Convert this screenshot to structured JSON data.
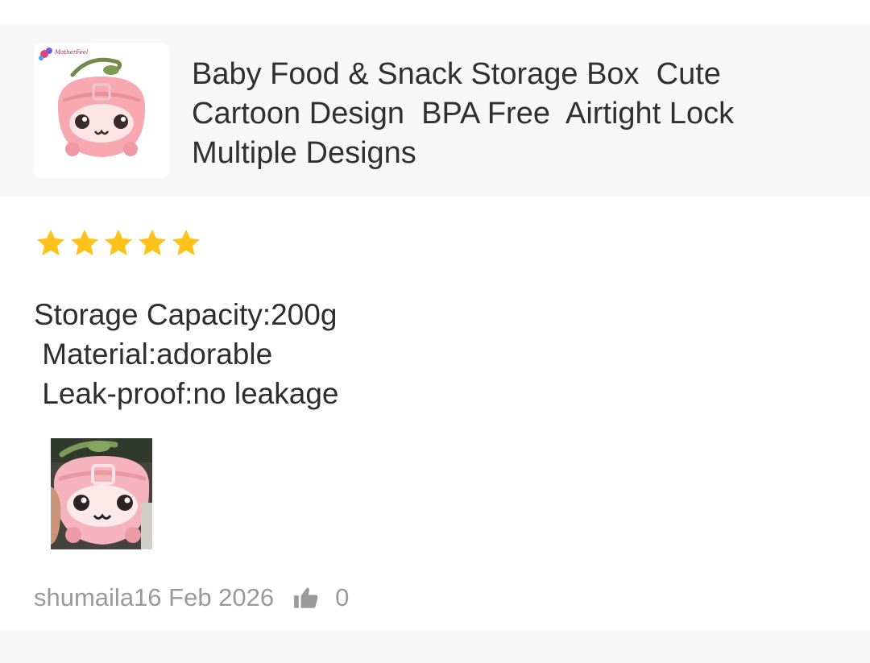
{
  "product": {
    "title": "Baby Food & Snack Storage Box  Cute\nCartoon Design  BPA Free  Airtight Lock\nMultiple Designs",
    "thumbnail_icon": "pink-apple-storage-box-image",
    "thumbnail_brand_text": "MotherFeel"
  },
  "review": {
    "rating": 5,
    "rating_max": 5,
    "star_color": "#FFC21A",
    "text": "Storage Capacity:200g\n Material:adorable\n Leak-proof:no leakage",
    "photo_icon": "pink-apple-storage-box-photo",
    "reviewer": "shumaila",
    "date": "16 Feb 2026",
    "like_icon": "thumbs-up-icon",
    "likes": "0"
  }
}
